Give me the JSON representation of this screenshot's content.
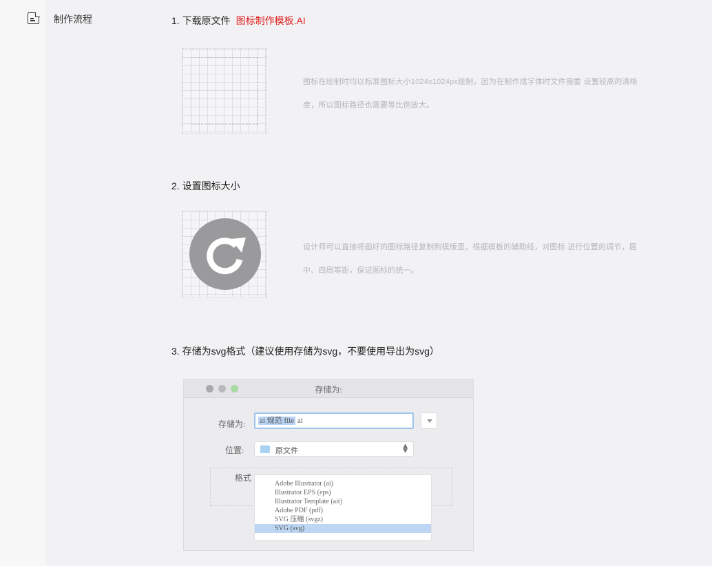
{
  "section": {
    "title": "制作流程",
    "icon": "document-icon"
  },
  "steps": [
    {
      "title": "1. 下载原文件",
      "link": "图标制作模板.AI",
      "description": "图标在绘制时均以标准图标大小1024x1024px绘制，因为在制作成字体时文件需要 设置较高的清晰度，所以图标路径也需要等比例放大。"
    },
    {
      "title": "2. 设置图标大小",
      "description": "设计师可以直接将画好的图标路径复制到模版里，根据模板的辅助线，对图标 进行位置的调节，居中、四周等距，保证图标的统一。"
    },
    {
      "title": "3. 存储为svg格式（建议使用存储为svg，不要使用导出为svg）"
    }
  ],
  "dialog": {
    "title": "存储为:",
    "save_as_label": "存储为:",
    "filename_selected": "ai 规范 file",
    "filename_ext": " ai",
    "location_label": "位置:",
    "location_value": "原文件",
    "format_label": "格式",
    "formats": [
      "Adobe Illustrator (ai)",
      "Illustrator EPS (eps)",
      "Illustrator Template (ait)",
      "Adobe PDF (pdf)",
      "SVG 压缩 (svgz)",
      "SVG (svg)"
    ],
    "selected_format": "SVG (svg)",
    "colors": {
      "selection": "#bcd6f3",
      "focus_border": "#9fc4f0",
      "folder": "#a9d1f2"
    }
  },
  "colors": {
    "link": "#e02020",
    "muted_text": "#b5b5bd"
  }
}
